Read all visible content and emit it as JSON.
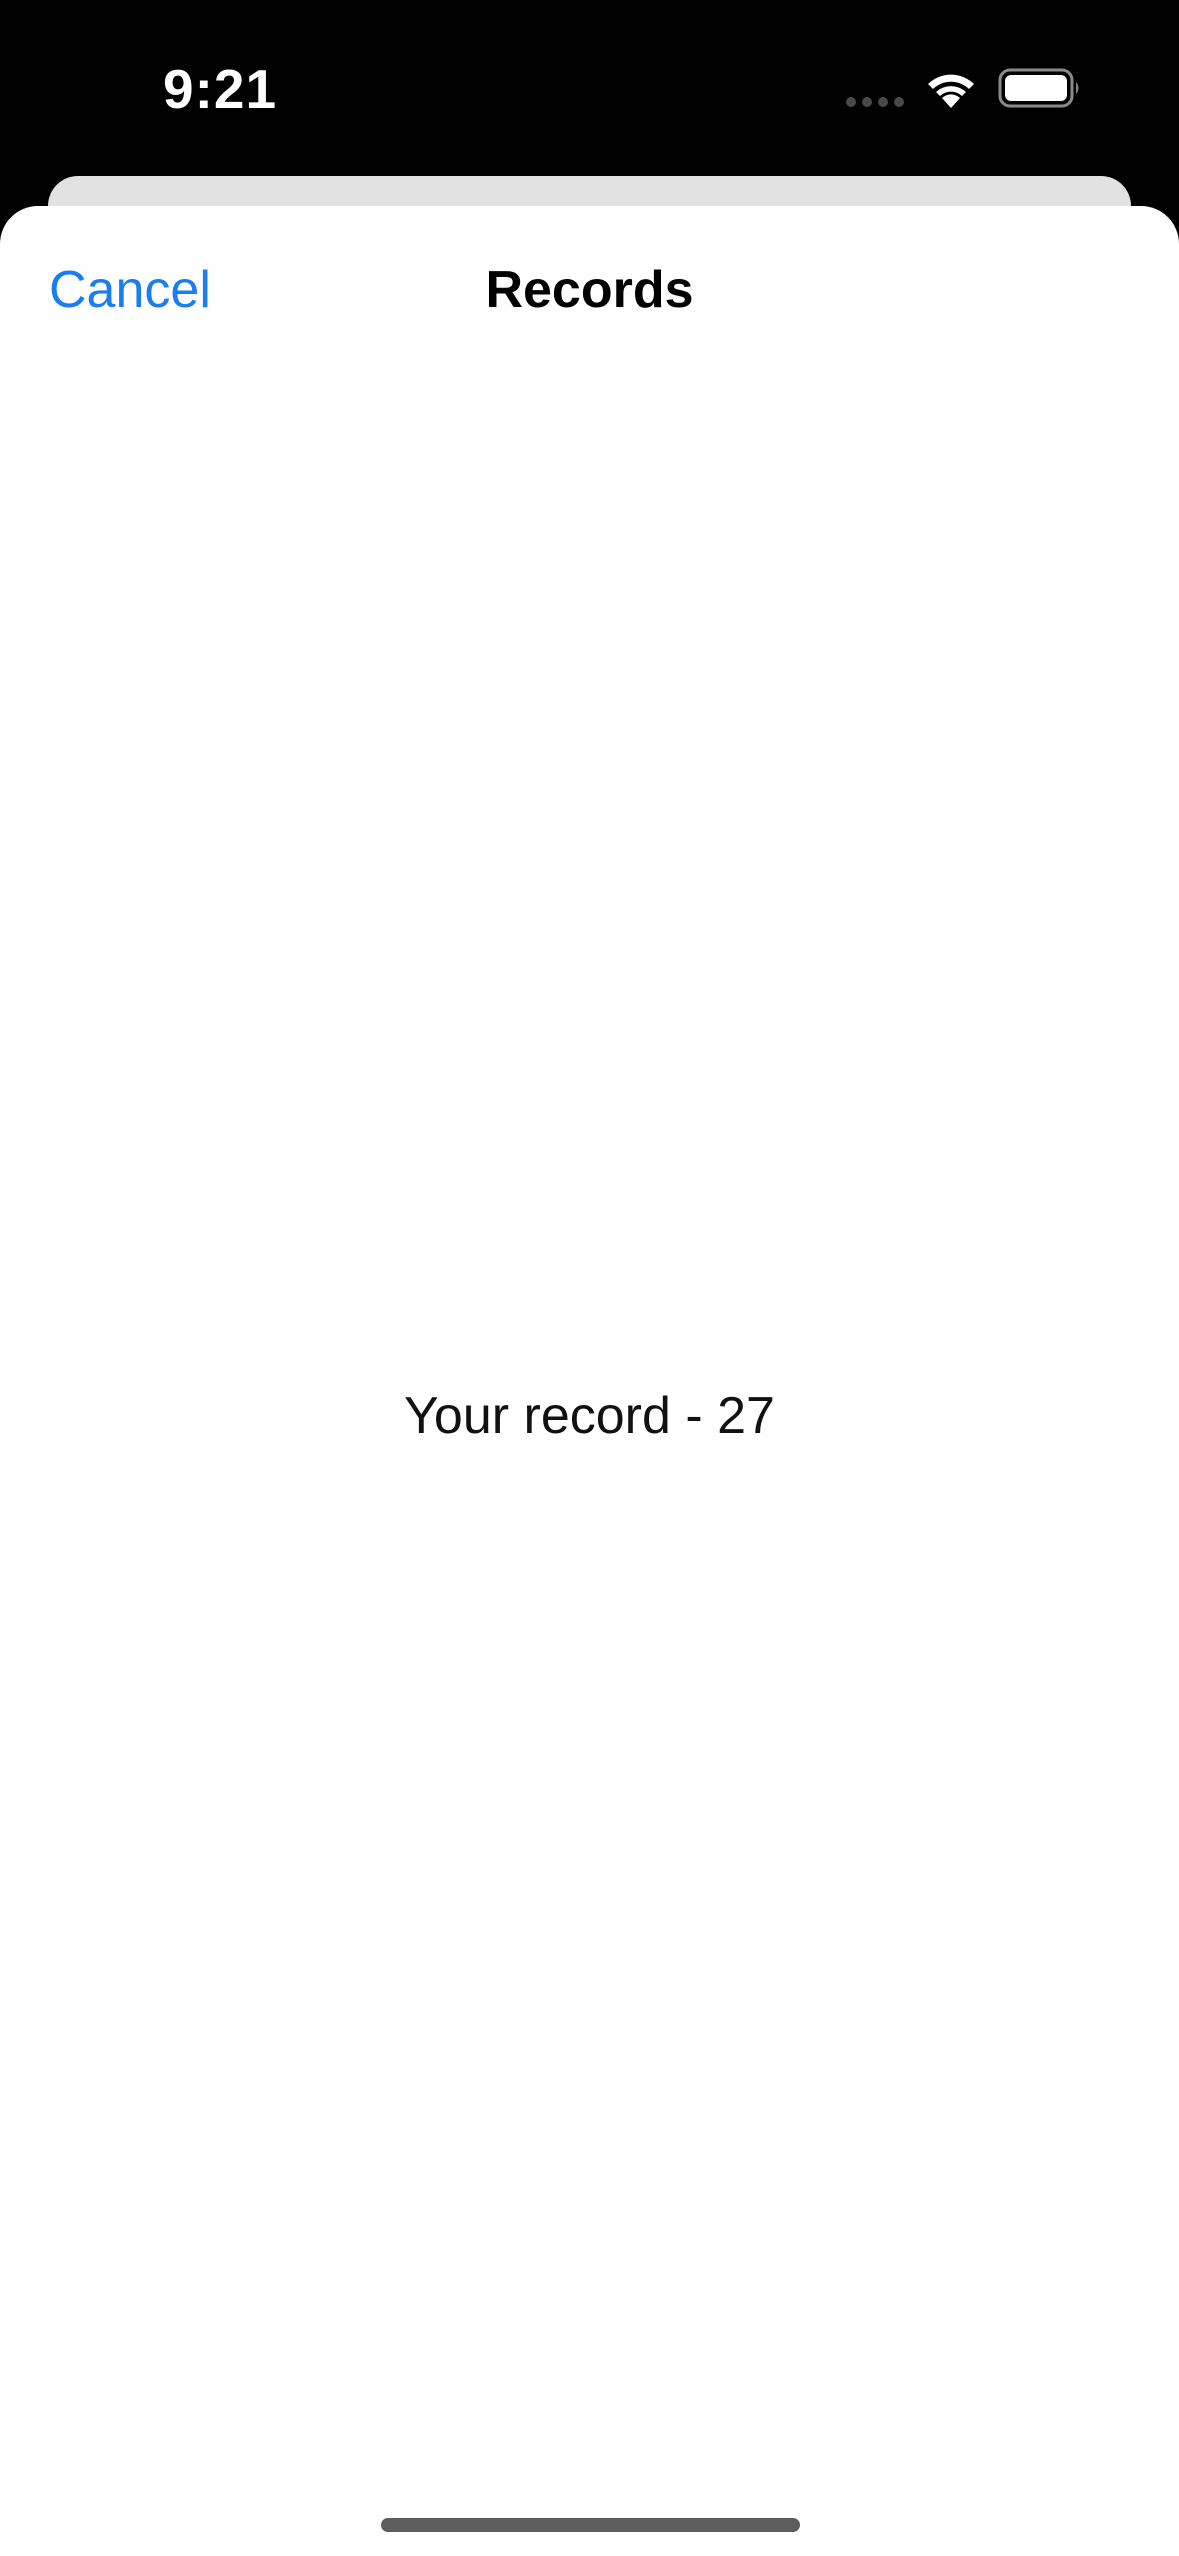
{
  "status_bar": {
    "time": "9:21",
    "icons": [
      "cellular-signal-icon",
      "wifi-icon",
      "battery-icon"
    ],
    "text_color": "#ffffff"
  },
  "nav": {
    "cancel_label": "Cancel",
    "title": "Records"
  },
  "content": {
    "record_text": "Your record - 27"
  },
  "colors": {
    "accent": "#1a7ef0",
    "background": "#000000",
    "sheet": "#ffffff",
    "back_sheet": "#e2e2e2",
    "home_indicator": "#5d5d5d"
  }
}
